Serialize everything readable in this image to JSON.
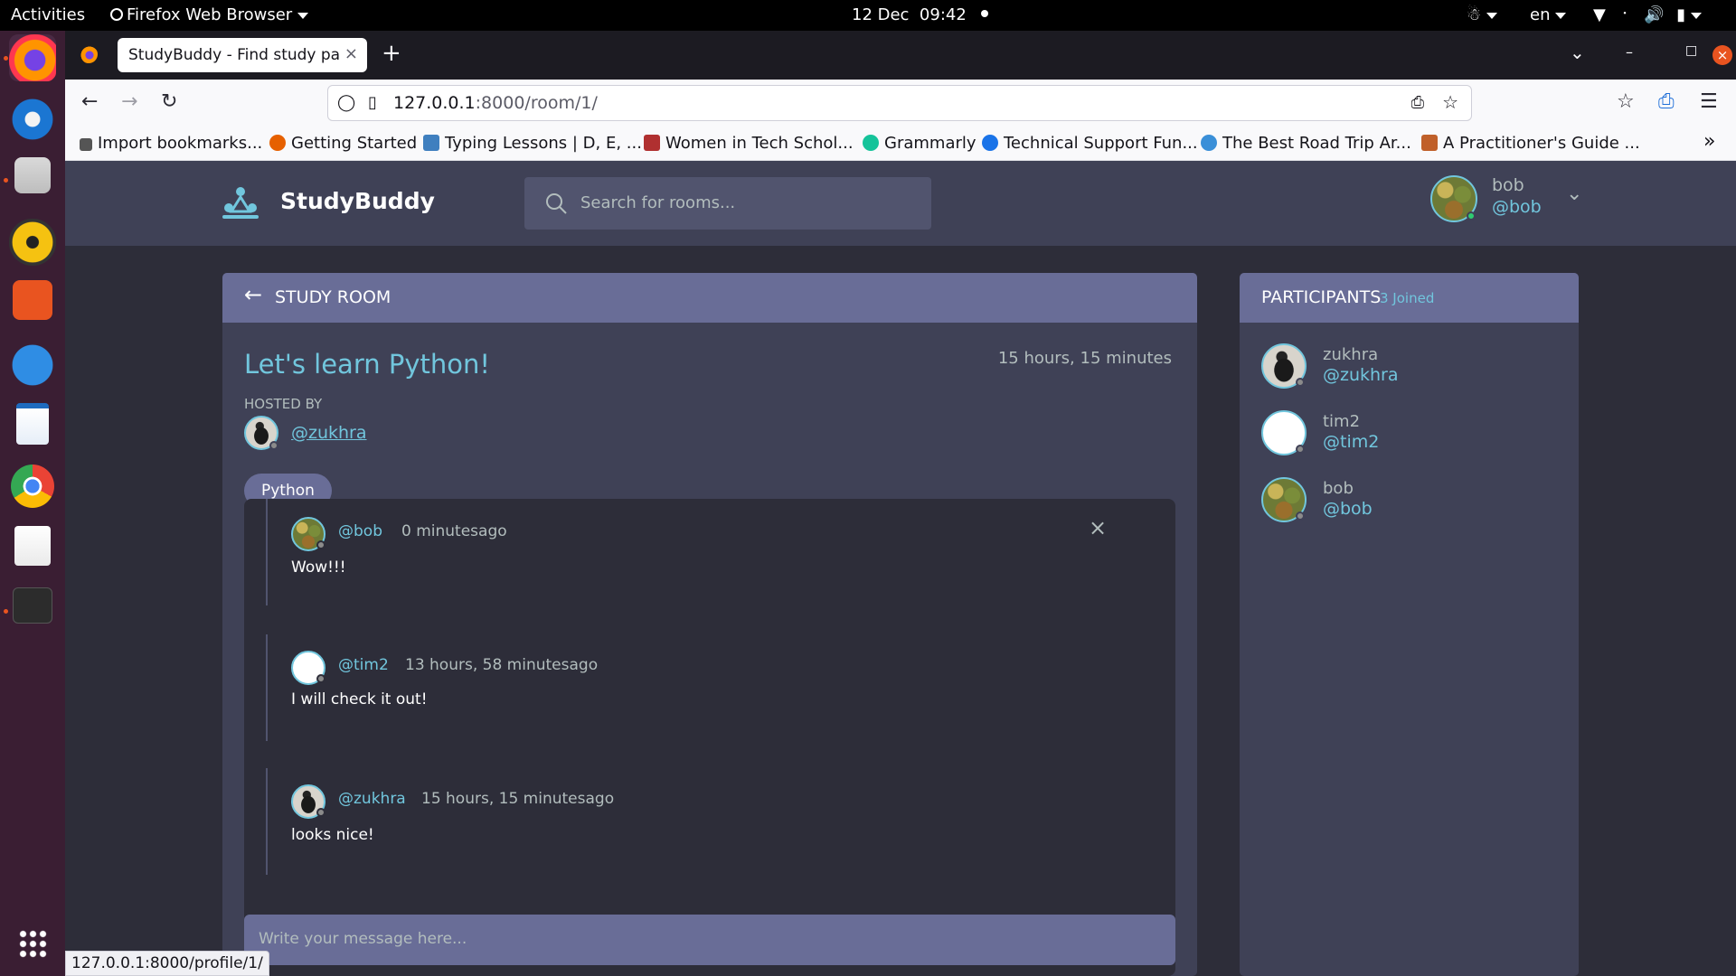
{
  "system": {
    "activities": "Activities",
    "app_menu": "Firefox Web Browser",
    "date": "12 Dec",
    "time": "09:42",
    "lang": "en"
  },
  "browser": {
    "tab_title": "StudyBuddy - Find study part",
    "url_host": "127.0.0.1",
    "url_rest": ":8000/room/1/",
    "status_url": "127.0.0.1:8000/profile/1/",
    "bookmarks": [
      {
        "label": "Import bookmarks...",
        "icon": "import-icon",
        "color": "#444"
      },
      {
        "label": "Getting Started",
        "icon": "firefox-icon",
        "color": "#e66000"
      },
      {
        "label": "Typing Lessons | D, E, ...",
        "icon": "typing-icon",
        "color": "#3f7fbf"
      },
      {
        "label": "Women in Tech Schol...",
        "icon": "shield-icon",
        "color": "#b03030"
      },
      {
        "label": "Grammarly",
        "icon": "grammarly-icon",
        "color": "#15c39a"
      },
      {
        "label": "Technical Support Fun...",
        "icon": "support-icon",
        "color": "#1a73e8"
      },
      {
        "label": "The Best Road Trip Ar...",
        "icon": "wifi-icon",
        "color": "#3a8fd8"
      },
      {
        "label": "A Practitioner's Guide ...",
        "icon": "person-icon",
        "color": "#c0602a"
      }
    ]
  },
  "app": {
    "brand": "StudyBuddy",
    "search_placeholder": "Search for rooms...",
    "user": {
      "name": "bob",
      "handle": "@bob"
    }
  },
  "room": {
    "header": "STUDY ROOM",
    "title": "Let's learn Python!",
    "age": "15 hours, 15 minutes",
    "hosted_by_label": "HOSTED BY",
    "host": "@zukhra",
    "topic": "Python",
    "messages": [
      {
        "user": "@bob",
        "time": "0 minutesago",
        "body": "Wow!!!",
        "avatar": "bob",
        "deletable": true
      },
      {
        "user": "@tim2",
        "time": "13 hours, 58 minutesago",
        "body": "I will check it out!",
        "avatar": "tim",
        "deletable": false
      },
      {
        "user": "@zukhra",
        "time": "15 hours, 15 minutesago",
        "body": "looks nice!",
        "avatar": "zuk",
        "deletable": false
      }
    ],
    "composer_placeholder": "Write your message here..."
  },
  "participants": {
    "title": "PARTICIPANTS",
    "count": "3 Joined",
    "list": [
      {
        "name": "zukhra",
        "handle": "@zukhra",
        "avatar": "zuk"
      },
      {
        "name": "tim2",
        "handle": "@tim2",
        "avatar": "tim"
      },
      {
        "name": "bob",
        "handle": "@bob",
        "avatar": "bob"
      }
    ]
  },
  "colors": {
    "accent": "#71c6dd",
    "panel": "#3f4156",
    "panel_header": "#696d97",
    "background": "#2d2d39"
  }
}
